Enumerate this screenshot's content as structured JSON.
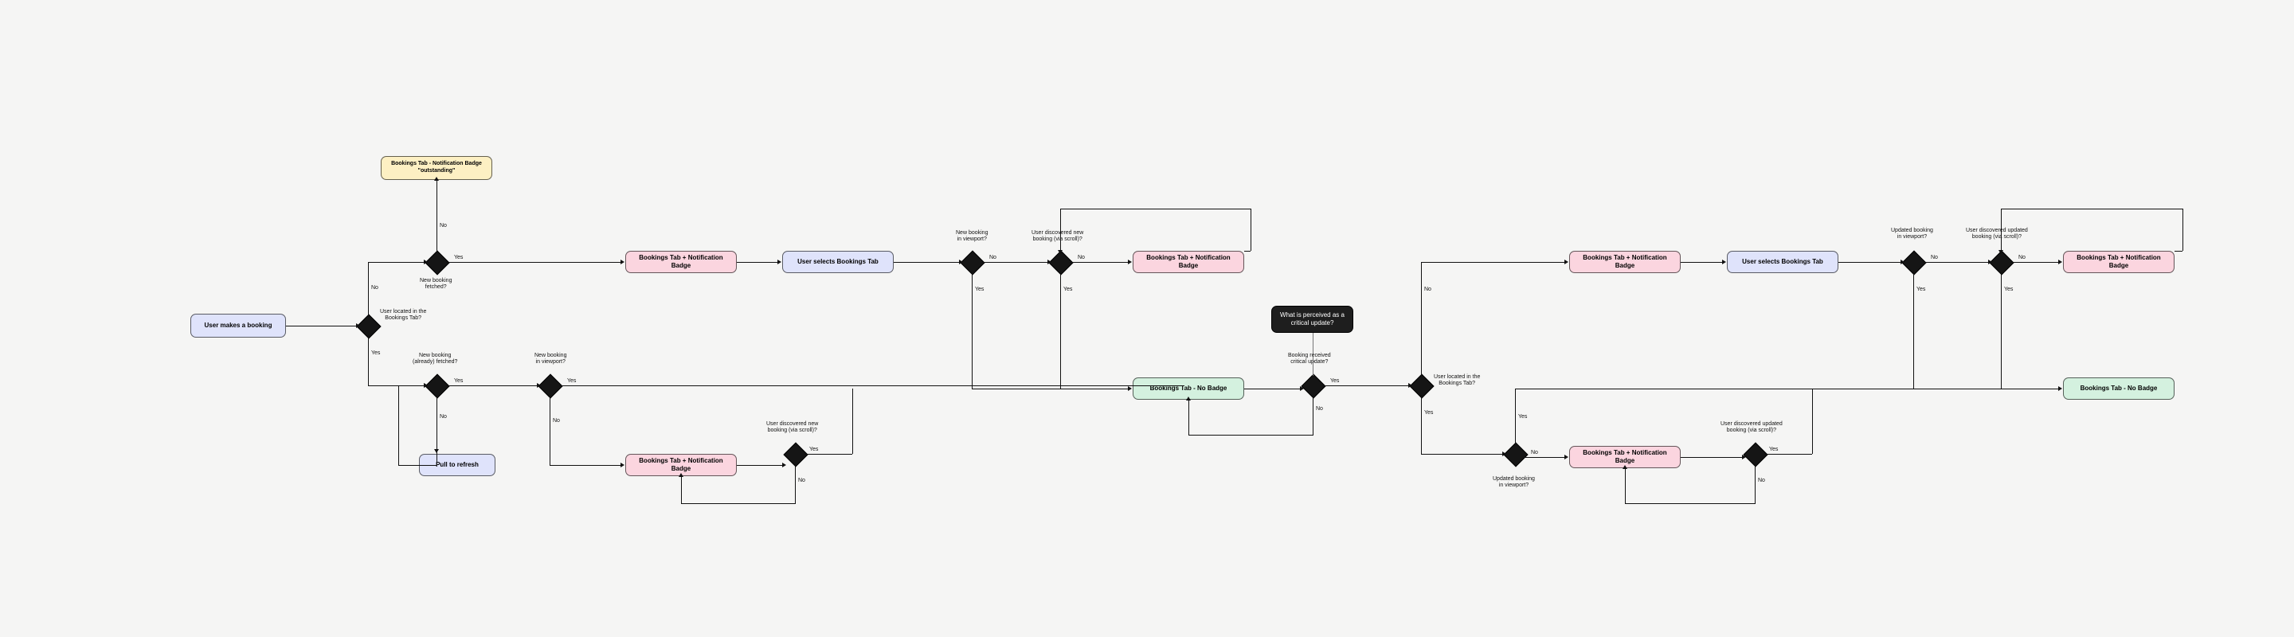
{
  "nodes": {
    "start": {
      "text": "User makes a booking"
    },
    "outstanding": {
      "text": "Bookings Tab - Notification Badge\n\"outstanding\""
    },
    "pull": {
      "text": "Pull to refresh"
    },
    "notifA": {
      "text": "Bookings Tab + Notification Badge"
    },
    "notifB": {
      "text": "Bookings Tab + Notification Badge"
    },
    "selectsA": {
      "text": "User selects Bookings Tab"
    },
    "notifC": {
      "text": "Bookings Tab + Notification Badge"
    },
    "nobadgeA": {
      "text": "Bookings Tab - No Badge"
    },
    "critical": {
      "text": "What is perceived as\na critical update?"
    },
    "notifD": {
      "text": "Bookings Tab + Notification Badge"
    },
    "notifE": {
      "text": "Bookings Tab + Notification Badge"
    },
    "selectsB": {
      "text": "User selects Bookings Tab"
    },
    "notifF": {
      "text": "Bookings Tab + Notification Badge"
    },
    "nobadgeB": {
      "text": "Bookings Tab - No Badge"
    }
  },
  "decision_labels": {
    "d1": "User located in the\nBookings Tab?",
    "d2": "New booking\nfetched?",
    "d3": "New booking\n(already) fetched?",
    "d4": "New booking\nin viewport?",
    "d5": "New booking\nin viewport?",
    "d6": "User discovered new\nbooking (via scroll)?",
    "d7": "User discovered new\nbooking (via scroll)?",
    "d8": "Booking received\ncritical update?",
    "d9": "User located in the\nBookings Tab?",
    "d10": "Updated booking\nin viewport?",
    "d11": "Updated booking\nin viewport?",
    "d12": "User discovered updated\nbooking (via scroll)?",
    "d13": "User discovered updated\nbooking (via scroll)?"
  },
  "edge_labels": {
    "yes": "Yes",
    "no": "No"
  }
}
